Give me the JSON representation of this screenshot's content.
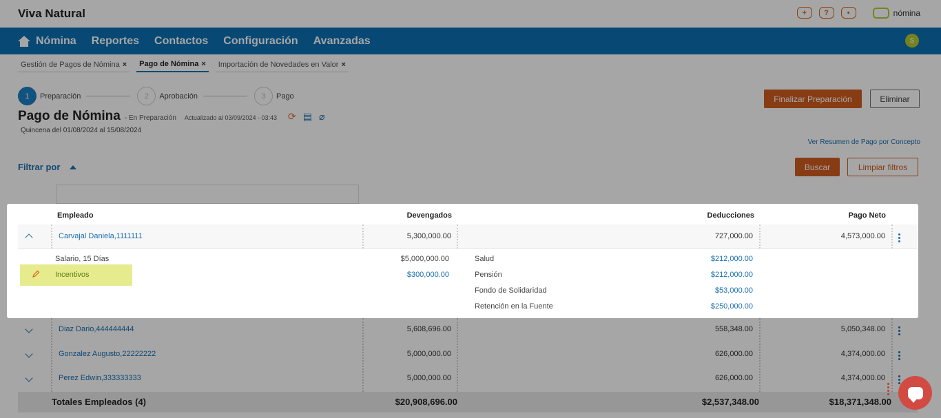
{
  "app": {
    "title": "Viva Natural",
    "brand": "nómina",
    "avatar": "S"
  },
  "top_icons": [
    "+",
    "?",
    "•"
  ],
  "nav": [
    "Nómina",
    "Reportes",
    "Contactos",
    "Configuración",
    "Avanzadas"
  ],
  "tabs": [
    {
      "label": "Gestión de Pagos de Nómina",
      "close": "×"
    },
    {
      "label": "Pago de Nómina",
      "close": "×"
    },
    {
      "label": "Importación de Novedades en Valor",
      "close": "×"
    }
  ],
  "steps": [
    {
      "num": "1",
      "label": "Preparación"
    },
    {
      "num": "2",
      "label": "Aprobación"
    },
    {
      "num": "3",
      "label": "Pago"
    }
  ],
  "page": {
    "title": "Pago de Nómina",
    "state": "- En Preparación",
    "updated": "Actualizado al 03/09/2024 - 03:43",
    "subtitle": "Quincena del 01/08/2024 al 15/08/2024"
  },
  "buttons": {
    "finalize": "Finalizar Preparación",
    "delete": "Eliminar",
    "search": "Buscar",
    "clear": "Limpiar filtros"
  },
  "summary_link": "Ver Resumen de Pago por Concepto",
  "filter": {
    "label": "Filtrar por"
  },
  "table": {
    "headers": {
      "employee": "Empleado",
      "earnings": "Devengados",
      "deductions": "Deducciones",
      "net": "Pago Neto"
    },
    "expanded": {
      "employee": "Carvajal Daniela,1111111",
      "earnings": "5,300,000.00",
      "deductions": "727,000.00",
      "net": "4,573,000.00",
      "earning_items": [
        {
          "label": "Salario, 15 Días",
          "value": "$5,000,000.00"
        },
        {
          "label": "Incentivos",
          "value": "$300,000.00"
        }
      ],
      "deduction_items": [
        {
          "label": "Salud",
          "value": "$212,000.00"
        },
        {
          "label": "Pensión",
          "value": "$212,000.00"
        },
        {
          "label": "Fondo de Solidaridad",
          "value": "$53,000.00"
        },
        {
          "label": "Retención en la Fuente",
          "value": "$250,000.00"
        }
      ]
    },
    "rows": [
      {
        "employee": "Diaz Dario,444444444",
        "earnings": "5,608,696.00",
        "deductions": "558,348.00",
        "net": "5,050,348.00"
      },
      {
        "employee": "Gonzalez Augusto,22222222",
        "earnings": "5,000,000.00",
        "deductions": "626,000.00",
        "net": "4,374,000.00"
      },
      {
        "employee": "Perez Edwin,333333333",
        "earnings": "5,000,000.00",
        "deductions": "626,000.00",
        "net": "4,374,000.00"
      }
    ],
    "totals": {
      "label": "Totales Empleados (4)",
      "earnings": "$20,908,696.00",
      "deductions": "$2,537,348.00",
      "net": "$18,371,348.00"
    }
  },
  "colors": {
    "primary": "#0b71b2",
    "accent": "#d25d1f",
    "highlight": "#e6ec8e"
  }
}
